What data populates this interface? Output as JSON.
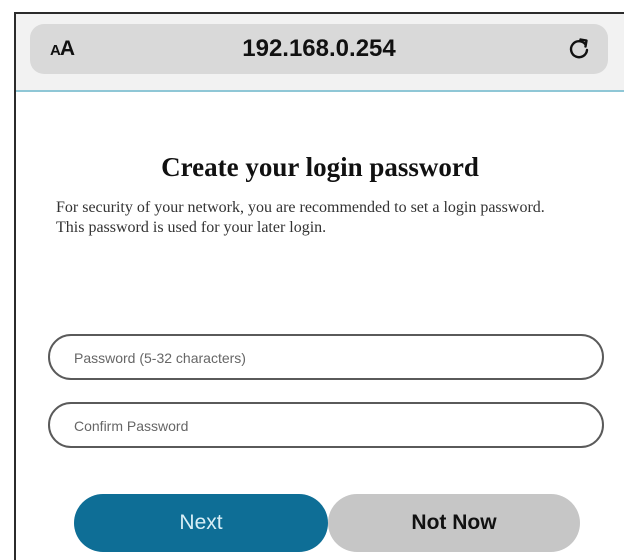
{
  "browser": {
    "text_size_label": "AA",
    "url": "192.168.0.254"
  },
  "page": {
    "title": "Create your login password",
    "description_line1": "For security of your network, you are recommended to set a login password.",
    "description_line2": "This password is used for your later login.",
    "password_placeholder": "Password (5-32 characters)",
    "confirm_placeholder": "Confirm Password",
    "next_label": "Next",
    "not_now_label": "Not Now"
  },
  "colors": {
    "next_button": "#0e6e96",
    "not_now_button": "#c6c6c6",
    "url_bar": "#d9d9d9",
    "divider": "#8fc7d6"
  }
}
